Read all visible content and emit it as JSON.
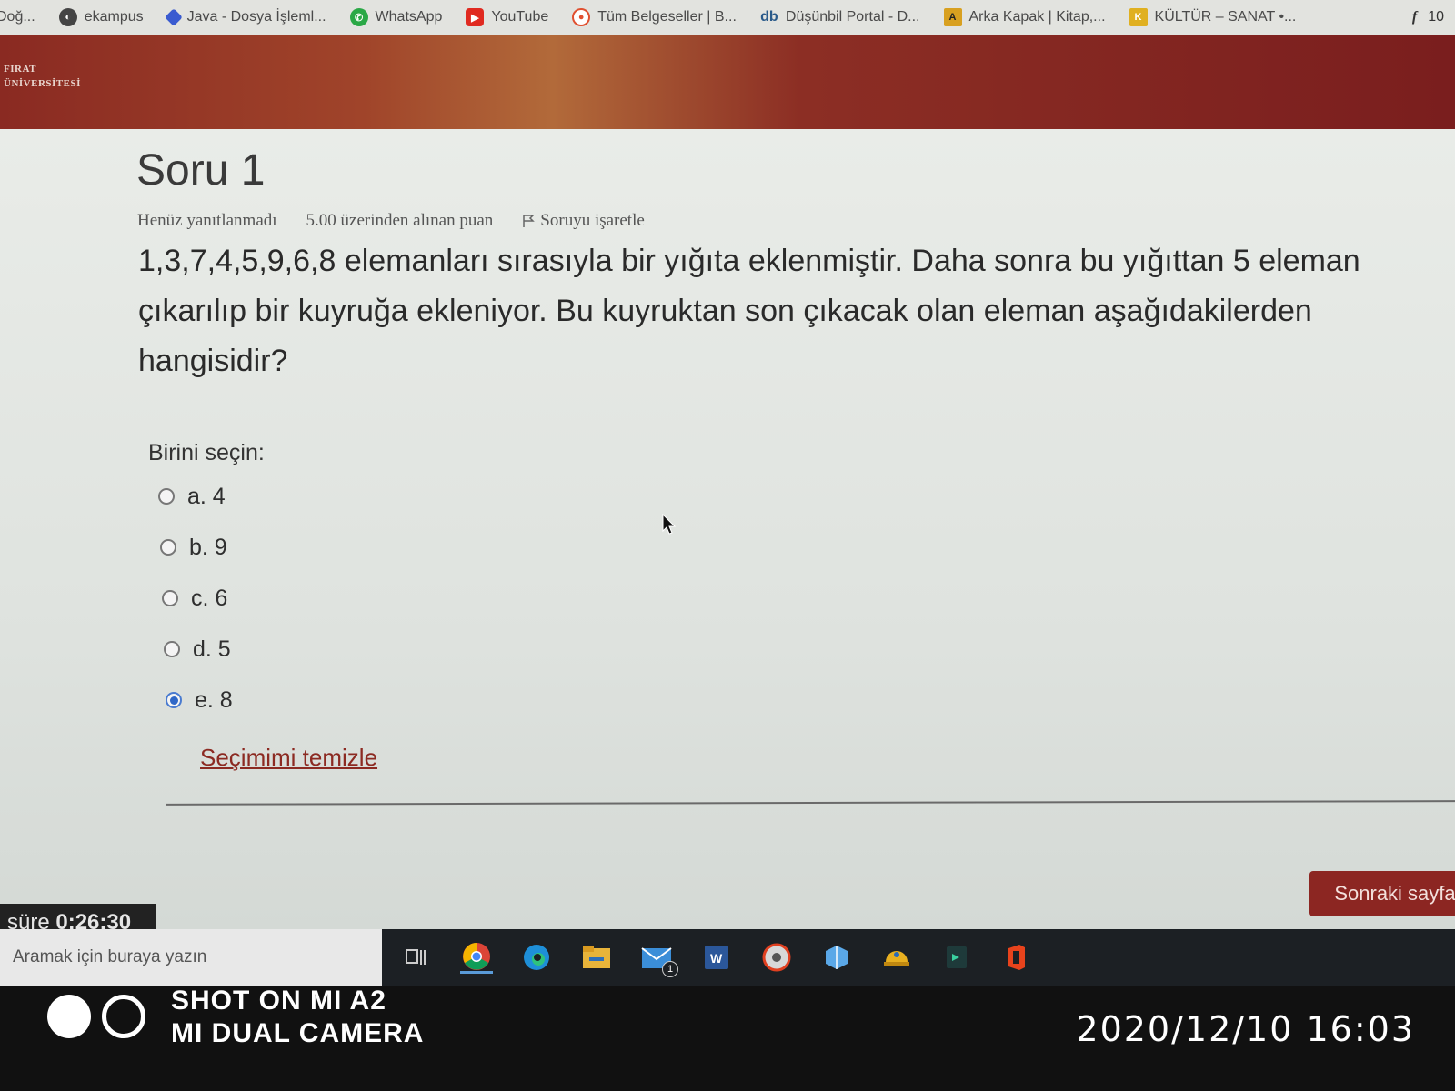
{
  "bookmarks": [
    {
      "label": "Doğ...",
      "icon": "bookmark-icon",
      "color": "#888888"
    },
    {
      "label": "ekampus",
      "icon": "ekampus-icon",
      "color": "#444444"
    },
    {
      "label": "Java - Dosya İşleml...",
      "icon": "java-diamond-icon",
      "color": "#3a5bd0"
    },
    {
      "label": "WhatsApp",
      "icon": "whatsapp-icon",
      "color": "#2aa846"
    },
    {
      "label": "YouTube",
      "icon": "youtube-icon",
      "color": "#e02a20"
    },
    {
      "label": "Tüm Belgeseller | B...",
      "icon": "belgesel-icon",
      "color": "#e05030"
    },
    {
      "label": "Düşünbil Portal - D...",
      "icon": "db-icon",
      "color": "#2a5a8a"
    },
    {
      "label": "Arka Kapak | Kitap,...",
      "icon": "arka-kapak-icon",
      "color": "#d8a020"
    },
    {
      "label": "KÜLTÜR – SANAT •...",
      "icon": "kultur-icon",
      "color": "#e0b020"
    }
  ],
  "bookmark_extra": {
    "facebook": "f",
    "count": "10"
  },
  "header": {
    "logo_line1": "FIRAT",
    "logo_line2": "ÜNİVERSİTESİ"
  },
  "question": {
    "title": "Soru 1",
    "status": "Henüz yanıtlanmadı",
    "points": "5.00 üzerinden alınan puan",
    "flag_label": "Soruyu işaretle",
    "text": "1,3,7,4,5,9,6,8 elemanları sırasıyla bir yığıta eklenmiştir. Daha sonra bu yığıttan 5 eleman çıkarılıp bir kuyruğa ekleniyor. Bu kuyruktan son çıkacak olan eleman aşağıdakilerden hangisidir?",
    "prompt": "Birini seçin:",
    "options": [
      {
        "label": "a. 4",
        "selected": false
      },
      {
        "label": "b. 9",
        "selected": false
      },
      {
        "label": "c. 6",
        "selected": false
      },
      {
        "label": "d. 5",
        "selected": false
      },
      {
        "label": "e. 8",
        "selected": true
      }
    ],
    "clear_label": "Seçimimi temizle",
    "next_label": "Sonraki sayfa"
  },
  "timer": {
    "label": "süre",
    "value": "0:26:30"
  },
  "taskbar": {
    "search_placeholder": "Aramak için buraya yazın",
    "apps": [
      "task-view-icon",
      "chrome-icon",
      "edge-icon",
      "file-explorer-icon",
      "mail-icon",
      "word-icon",
      "media-icon",
      "box-icon",
      "helmet-icon",
      "app-icon",
      "office-icon"
    ],
    "mail_badge": "1"
  },
  "camera": {
    "line1": "SHOT ON MI A2",
    "line2": "MI DUAL CAMERA",
    "datetime": "2020/12/10  16:03"
  },
  "colors": {
    "accent": "#8c2622",
    "radio_selected": "#2f67c7",
    "header": "#8a2a22"
  }
}
